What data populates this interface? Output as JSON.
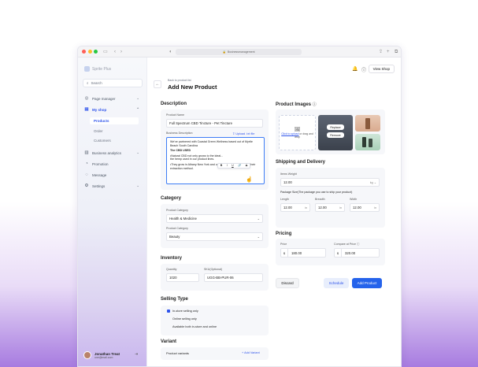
{
  "browser": {
    "url": "Businessmanagement"
  },
  "sidebar": {
    "brand": "Sprite Plus",
    "search_placeholder": "Search",
    "items": [
      {
        "label": "Page manager"
      },
      {
        "label": "My shop"
      },
      {
        "label": "Business analytics"
      },
      {
        "label": "Promotion"
      },
      {
        "label": "Message"
      },
      {
        "label": "Settings"
      }
    ],
    "subitems": [
      {
        "label": "Products"
      },
      {
        "label": "Order"
      },
      {
        "label": "Customers"
      }
    ],
    "user": {
      "name": "Jonathan Treat",
      "email": "one@mail.com"
    }
  },
  "header": {
    "breadcrumb": "Back to product list",
    "title": "Add New Product",
    "view_shop": "View Shop"
  },
  "description": {
    "section": "Description",
    "name_label": "Product Name",
    "name_value": "Full Spectrum CBD Tincture - Pet Tincture",
    "desc_label": "Business Description",
    "upload_link": "Upload .txt file",
    "para1": "We've partnered with Coastal Green Wellness based out of Myrtle Beach South Carolina",
    "heading": "The CBD USED",
    "bullet1": "•Natural CBD not only grows to the ideal... the hemp used in our product lines.",
    "bullet2_a": "•They grow in Albany New York and use ",
    "bullet2_hl": "CO2",
    "bullet2_b": " as the solvent for their extraction method.",
    "toolbar": [
      "B",
      "I",
      "U",
      "🔗",
      "S"
    ]
  },
  "category": {
    "section": "Category",
    "product_category_label": "Product Category",
    "product_category_value": "Health & Medicine",
    "product_category2_label": "Product Category",
    "product_category2_value": "Beauty"
  },
  "inventory": {
    "section": "Inventory",
    "quantity_label": "Quantity",
    "quantity_value": "1020",
    "sku_label": "SKU(Optional)",
    "sku_value": "UGG-BB-PUR-06"
  },
  "selling": {
    "section": "Selling Type",
    "options": [
      "In-store selling only",
      "Online selling only",
      "Available both in-store and online"
    ]
  },
  "variant": {
    "section": "Variant",
    "label": "Product variants",
    "add": "+ Add Variant"
  },
  "images": {
    "section": "Product Images",
    "upload_text_link": "Click to upload",
    "upload_text_rest": " or drag and drop",
    "replace": "Replace",
    "remove": "Remove"
  },
  "shipping": {
    "section": "Shipping and Delivery",
    "weight_label": "Items Weight",
    "weight_value": "12.00",
    "weight_unit": "kg",
    "size_label": "Package Size(The package you use to ship your product)",
    "length_label": "Length",
    "length_value": "12.00",
    "breadth_label": "Breadth",
    "breadth_value": "12.00",
    "width_label": "Width",
    "width_value": "12.00",
    "dim_unit": "in"
  },
  "pricing": {
    "section": "Pricing",
    "price_label": "Price",
    "price_value": "180.00",
    "compare_label": "Compare at Price",
    "compare_value": "320.00",
    "currency": "$"
  },
  "actions": {
    "discard": "Discard",
    "schedule": "Schedule",
    "add": "Add Product"
  },
  "colors": {
    "accent": "#2f54eb",
    "primary_button": "#2563eb"
  }
}
